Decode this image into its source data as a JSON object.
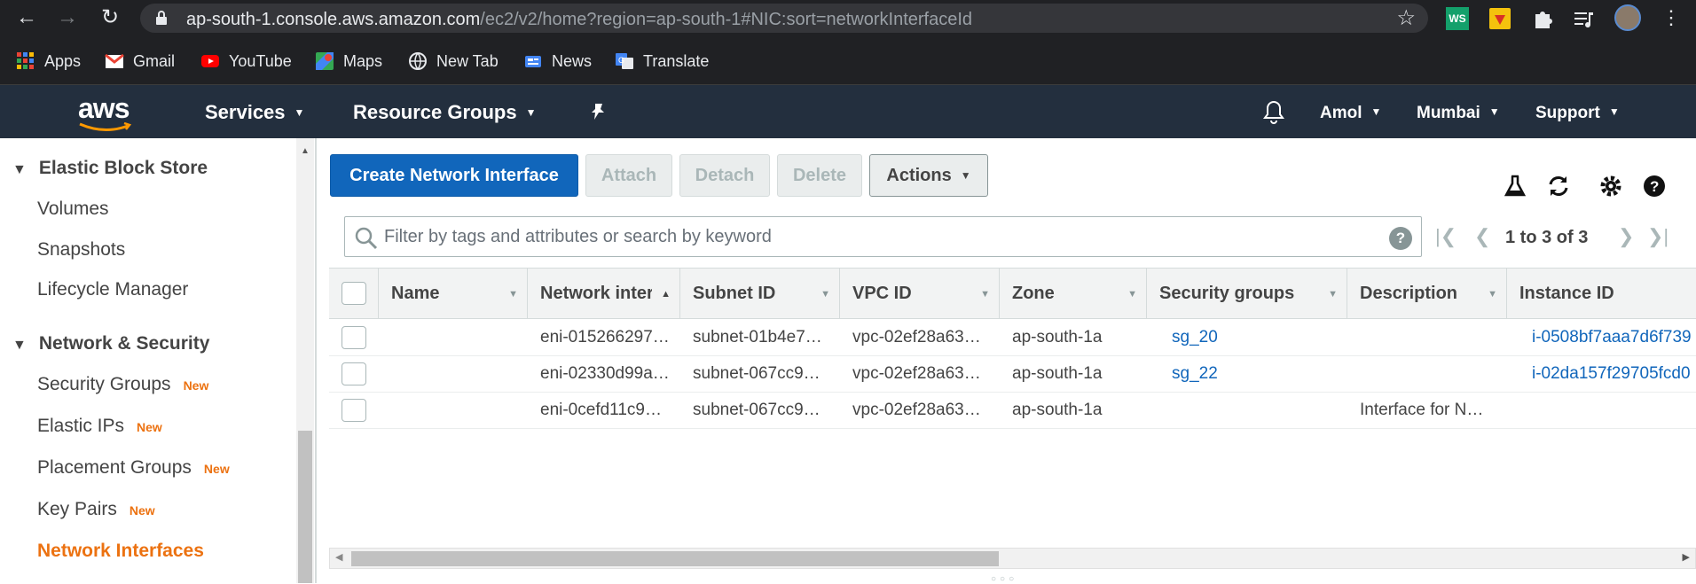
{
  "browser": {
    "url_main": "ap-south-1.console.aws.amazon.com",
    "url_rest": "/ec2/v2/home?region=ap-south-1#NIC:sort=networkInterfaceId",
    "ext_ws_label": "WS"
  },
  "bookmarks": [
    {
      "label": "Apps",
      "icon": "apps-grid-icon"
    },
    {
      "label": "Gmail",
      "icon": "gmail-icon"
    },
    {
      "label": "YouTube",
      "icon": "youtube-icon"
    },
    {
      "label": "Maps",
      "icon": "maps-icon"
    },
    {
      "label": "New Tab",
      "icon": "globe-icon"
    },
    {
      "label": "News",
      "icon": "news-icon"
    },
    {
      "label": "Translate",
      "icon": "translate-icon"
    }
  ],
  "header": {
    "logo": "aws",
    "services": "Services",
    "resource_groups": "Resource Groups",
    "user": "Amol",
    "region": "Mumbai",
    "support": "Support"
  },
  "sidebar": {
    "ebs_heading": "Elastic Block Store",
    "ebs_items": [
      "Volumes",
      "Snapshots",
      "Lifecycle Manager"
    ],
    "netsec_heading": "Network & Security",
    "netsec_items": [
      {
        "label": "Security Groups",
        "badge": "New"
      },
      {
        "label": "Elastic IPs",
        "badge": "New"
      },
      {
        "label": "Placement Groups",
        "badge": "New"
      },
      {
        "label": "Key Pairs",
        "badge": "New"
      },
      {
        "label": "Network Interfaces",
        "badge": ""
      }
    ]
  },
  "toolbar": {
    "create": "Create Network Interface",
    "attach": "Attach",
    "detach": "Detach",
    "delete": "Delete",
    "actions": "Actions"
  },
  "filter": {
    "placeholder": "Filter by tags and attributes or search by keyword",
    "help": "?"
  },
  "pagination": {
    "text": "1 to 3 of 3"
  },
  "table": {
    "columns": [
      "Name",
      "Network interfa",
      "Subnet ID",
      "VPC ID",
      "Zone",
      "Security groups",
      "Description",
      "Instance ID"
    ],
    "rows": [
      {
        "name": "",
        "eni": "eni-015266297…",
        "subnet": "subnet-01b4e7…",
        "vpc": "vpc-02ef28a63…",
        "zone": "ap-south-1a",
        "sg": "sg_20",
        "desc": "",
        "instance": "i-0508bf7aaa7d6f739"
      },
      {
        "name": "",
        "eni": "eni-02330d99a…",
        "subnet": "subnet-067cc9…",
        "vpc": "vpc-02ef28a63…",
        "zone": "ap-south-1a",
        "sg": "sg_22",
        "desc": "",
        "instance": "i-02da157f29705fcd0"
      },
      {
        "name": "",
        "eni": "eni-0cefd11c9…",
        "subnet": "subnet-067cc9…",
        "vpc": "vpc-02ef28a63…",
        "zone": "ap-south-1a",
        "sg": "",
        "desc": "Interface for N…",
        "instance": ""
      }
    ]
  },
  "colors": {
    "aws_header": "#232f3e",
    "primary_button": "#1166bb",
    "accent_orange": "#ec7211",
    "link": "#1166bb"
  }
}
